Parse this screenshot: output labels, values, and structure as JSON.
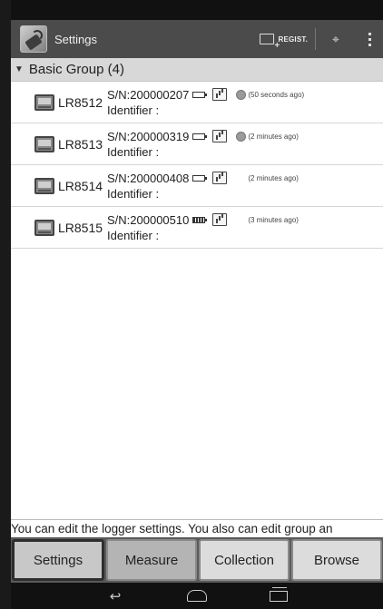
{
  "app": {
    "title": "Settings"
  },
  "actionbar": {
    "regist_label": "REGIST."
  },
  "group": {
    "label": "Basic Group (4)"
  },
  "devices": [
    {
      "model": "LR8512",
      "serial": "S/N:200000207",
      "identifier": "Identifier :",
      "time": "(50 seconds ago)",
      "battery": "plug",
      "has_globe": true
    },
    {
      "model": "LR8513",
      "serial": "S/N:200000319",
      "identifier": "Identifier :",
      "time": "(2 minutes ago)",
      "battery": "plug",
      "has_globe": true
    },
    {
      "model": "LR8514",
      "serial": "S/N:200000408",
      "identifier": "Identifier :",
      "time": "(2 minutes ago)",
      "battery": "plug",
      "has_globe": false
    },
    {
      "model": "LR8515",
      "serial": "S/N:200000510",
      "identifier": "Identifier :",
      "time": "(3 minutes ago)",
      "battery": "full",
      "has_globe": false
    }
  ],
  "message": "You can edit the logger settings. You also can edit group an",
  "tabs": [
    {
      "label": "Settings",
      "state": "selected"
    },
    {
      "label": "Measure",
      "state": "dim"
    },
    {
      "label": "Collection",
      "state": "normal"
    },
    {
      "label": "Browse",
      "state": "normal"
    }
  ]
}
